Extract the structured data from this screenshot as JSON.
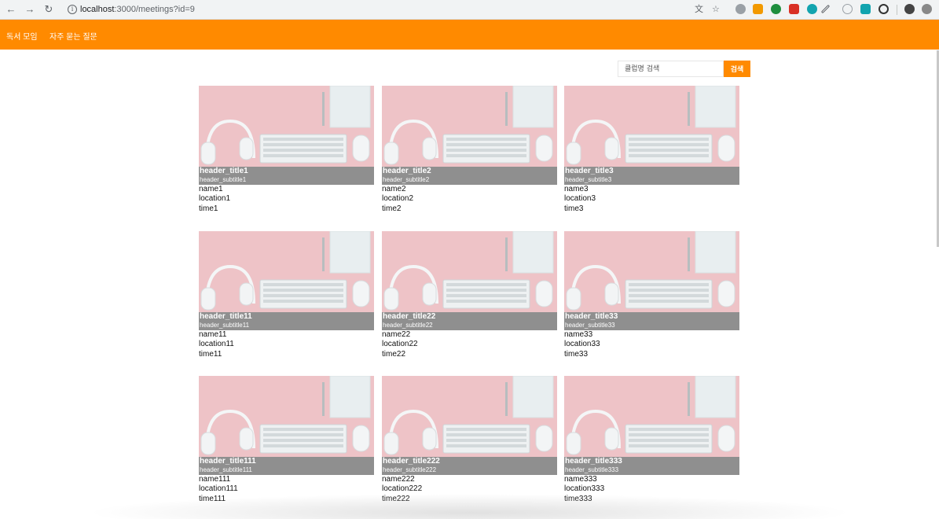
{
  "browser": {
    "url_host": "localhost",
    "url_rest": ":3000/meetings?id=9",
    "back_icon": "arrow-left-icon",
    "forward_icon": "arrow-right-icon",
    "reload_icon": "reload-icon"
  },
  "appbar": {
    "menu": [
      "독서 모임",
      "자주 묻는 질문"
    ],
    "color": "#ff8a00"
  },
  "search": {
    "placeholder": "클럽명 검색",
    "button_label": "검색"
  },
  "cards": [
    {
      "title": "header_title1",
      "subtitle": "header_subtitle1",
      "name": "name1",
      "location": "location1",
      "time": "time1"
    },
    {
      "title": "header_title2",
      "subtitle": "header_subtitle2",
      "name": "name2",
      "location": "location2",
      "time": "time2"
    },
    {
      "title": "header_title3",
      "subtitle": "header_subtitle3",
      "name": "name3",
      "location": "location3",
      "time": "time3"
    },
    {
      "title": "header_title11",
      "subtitle": "header_subtitle11",
      "name": "name11",
      "location": "location11",
      "time": "time11"
    },
    {
      "title": "header_title22",
      "subtitle": "header_subtitle22",
      "name": "name22",
      "location": "location22",
      "time": "time22"
    },
    {
      "title": "header_title33",
      "subtitle": "header_subtitle33",
      "name": "name33",
      "location": "location33",
      "time": "time33"
    },
    {
      "title": "header_title111",
      "subtitle": "header_subtitle111",
      "name": "name111",
      "location": "location111",
      "time": "time111"
    },
    {
      "title": "header_title222",
      "subtitle": "header_subtitle222",
      "name": "name222",
      "location": "location222",
      "time": "time222"
    },
    {
      "title": "header_title333",
      "subtitle": "header_subtitle333",
      "name": "name333",
      "location": "location333",
      "time": "time333"
    }
  ]
}
